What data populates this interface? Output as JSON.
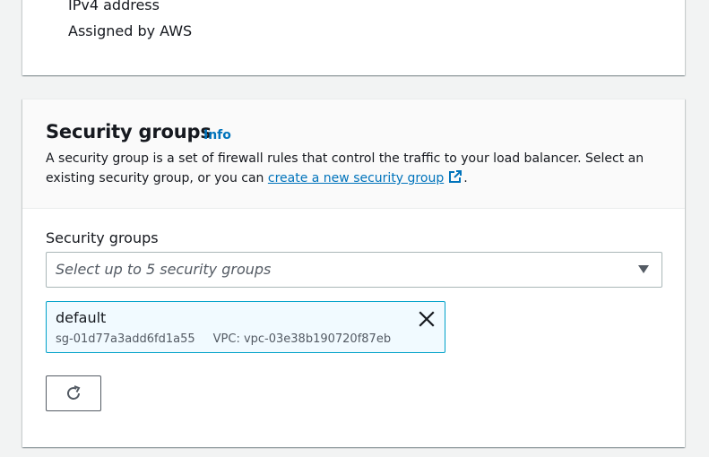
{
  "network_mapping": {
    "ipv4_label": "IPv4 address",
    "ipv4_value": "Assigned by AWS"
  },
  "security_groups_section": {
    "title": "Security groups",
    "info_link": "Info",
    "description_prefix": "A security group is a set of firewall rules that control the traffic to your load balancer. Select an existing security group, or you can ",
    "create_link": "create a new security group",
    "description_suffix": ".",
    "field_label": "Security groups",
    "select_placeholder": "Select up to 5 security groups",
    "selected_groups": [
      {
        "name": "default",
        "id": "sg-01d77a3add6fd1a55",
        "vpc": "VPC: vpc-03e38b190720f87eb"
      }
    ],
    "icons": {
      "external_link": "external-link-icon",
      "caret": "caret-down-icon",
      "remove": "close-icon",
      "refresh": "refresh-icon"
    },
    "colors": {
      "link": "#0073bb",
      "token_bg": "#f1faff",
      "token_border": "#00a1c9"
    }
  }
}
